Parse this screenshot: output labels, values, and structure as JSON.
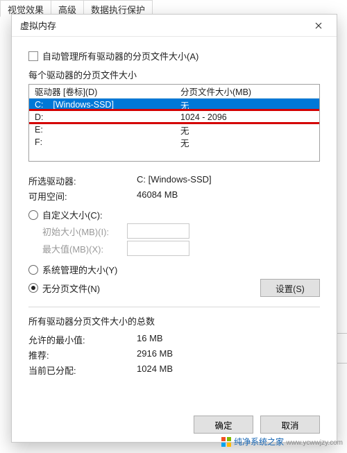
{
  "bg_tabs": {
    "t0": "视觉效果",
    "t1": "高级",
    "t2": "数据执行保护"
  },
  "dialog": {
    "title": "虚拟内存",
    "auto_manage": "自动管理所有驱动器的分页文件大小(A)",
    "per_drive_label": "每个驱动器的分页文件大小",
    "headers": {
      "drive": "驱动器 [卷标](D)",
      "size": "分页文件大小(MB)"
    },
    "drives": [
      {
        "letter": "C:",
        "vol": "[Windows-SSD]",
        "size": "无"
      },
      {
        "letter": "D:",
        "vol": "",
        "size": "1024 - 2096"
      },
      {
        "letter": "E:",
        "vol": "",
        "size": "无"
      },
      {
        "letter": "F:",
        "vol": "",
        "size": "无"
      }
    ],
    "selected_label": "所选驱动器:",
    "selected_value": "C:  [Windows-SSD]",
    "avail_label": "可用空间:",
    "avail_value": "46084 MB",
    "radio_custom": "自定义大小(C):",
    "field_init": "初始大小(MB)(I):",
    "field_max": "最大值(MB)(X):",
    "radio_sys": "系统管理的大小(Y)",
    "radio_none": "无分页文件(N)",
    "set_btn": "设置(S)",
    "totals_label": "所有驱动器分页文件大小的总数",
    "min_l": "允许的最小值:",
    "min_v": "16 MB",
    "rec_l": "推荐:",
    "rec_v": "2916 MB",
    "cur_l": "当前已分配:",
    "cur_v": "1024 MB",
    "ok": "确定",
    "cancel": "取消"
  },
  "watermark": {
    "host": "纯净系统之家",
    "url": "www.ycwwjzy.com"
  }
}
